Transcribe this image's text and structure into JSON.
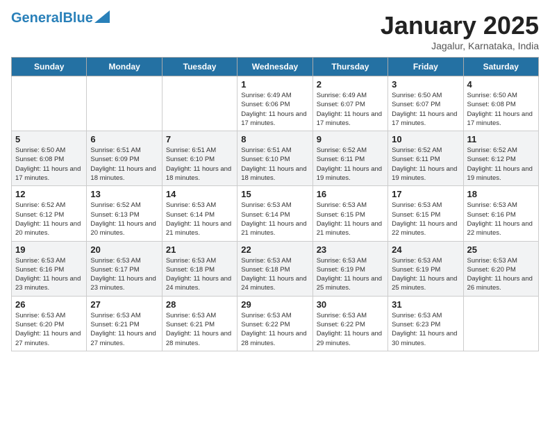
{
  "header": {
    "logo_line1": "General",
    "logo_line2": "Blue",
    "month": "January 2025",
    "location": "Jagalur, Karnataka, India"
  },
  "days_of_week": [
    "Sunday",
    "Monday",
    "Tuesday",
    "Wednesday",
    "Thursday",
    "Friday",
    "Saturday"
  ],
  "weeks": [
    [
      {
        "day": "",
        "info": ""
      },
      {
        "day": "",
        "info": ""
      },
      {
        "day": "",
        "info": ""
      },
      {
        "day": "1",
        "info": "Sunrise: 6:49 AM\nSunset: 6:06 PM\nDaylight: 11 hours and 17 minutes."
      },
      {
        "day": "2",
        "info": "Sunrise: 6:49 AM\nSunset: 6:07 PM\nDaylight: 11 hours and 17 minutes."
      },
      {
        "day": "3",
        "info": "Sunrise: 6:50 AM\nSunset: 6:07 PM\nDaylight: 11 hours and 17 minutes."
      },
      {
        "day": "4",
        "info": "Sunrise: 6:50 AM\nSunset: 6:08 PM\nDaylight: 11 hours and 17 minutes."
      }
    ],
    [
      {
        "day": "5",
        "info": "Sunrise: 6:50 AM\nSunset: 6:08 PM\nDaylight: 11 hours and 17 minutes."
      },
      {
        "day": "6",
        "info": "Sunrise: 6:51 AM\nSunset: 6:09 PM\nDaylight: 11 hours and 18 minutes."
      },
      {
        "day": "7",
        "info": "Sunrise: 6:51 AM\nSunset: 6:10 PM\nDaylight: 11 hours and 18 minutes."
      },
      {
        "day": "8",
        "info": "Sunrise: 6:51 AM\nSunset: 6:10 PM\nDaylight: 11 hours and 18 minutes."
      },
      {
        "day": "9",
        "info": "Sunrise: 6:52 AM\nSunset: 6:11 PM\nDaylight: 11 hours and 19 minutes."
      },
      {
        "day": "10",
        "info": "Sunrise: 6:52 AM\nSunset: 6:11 PM\nDaylight: 11 hours and 19 minutes."
      },
      {
        "day": "11",
        "info": "Sunrise: 6:52 AM\nSunset: 6:12 PM\nDaylight: 11 hours and 19 minutes."
      }
    ],
    [
      {
        "day": "12",
        "info": "Sunrise: 6:52 AM\nSunset: 6:12 PM\nDaylight: 11 hours and 20 minutes."
      },
      {
        "day": "13",
        "info": "Sunrise: 6:52 AM\nSunset: 6:13 PM\nDaylight: 11 hours and 20 minutes."
      },
      {
        "day": "14",
        "info": "Sunrise: 6:53 AM\nSunset: 6:14 PM\nDaylight: 11 hours and 21 minutes."
      },
      {
        "day": "15",
        "info": "Sunrise: 6:53 AM\nSunset: 6:14 PM\nDaylight: 11 hours and 21 minutes."
      },
      {
        "day": "16",
        "info": "Sunrise: 6:53 AM\nSunset: 6:15 PM\nDaylight: 11 hours and 21 minutes."
      },
      {
        "day": "17",
        "info": "Sunrise: 6:53 AM\nSunset: 6:15 PM\nDaylight: 11 hours and 22 minutes."
      },
      {
        "day": "18",
        "info": "Sunrise: 6:53 AM\nSunset: 6:16 PM\nDaylight: 11 hours and 22 minutes."
      }
    ],
    [
      {
        "day": "19",
        "info": "Sunrise: 6:53 AM\nSunset: 6:16 PM\nDaylight: 11 hours and 23 minutes."
      },
      {
        "day": "20",
        "info": "Sunrise: 6:53 AM\nSunset: 6:17 PM\nDaylight: 11 hours and 23 minutes."
      },
      {
        "day": "21",
        "info": "Sunrise: 6:53 AM\nSunset: 6:18 PM\nDaylight: 11 hours and 24 minutes."
      },
      {
        "day": "22",
        "info": "Sunrise: 6:53 AM\nSunset: 6:18 PM\nDaylight: 11 hours and 24 minutes."
      },
      {
        "day": "23",
        "info": "Sunrise: 6:53 AM\nSunset: 6:19 PM\nDaylight: 11 hours and 25 minutes."
      },
      {
        "day": "24",
        "info": "Sunrise: 6:53 AM\nSunset: 6:19 PM\nDaylight: 11 hours and 25 minutes."
      },
      {
        "day": "25",
        "info": "Sunrise: 6:53 AM\nSunset: 6:20 PM\nDaylight: 11 hours and 26 minutes."
      }
    ],
    [
      {
        "day": "26",
        "info": "Sunrise: 6:53 AM\nSunset: 6:20 PM\nDaylight: 11 hours and 27 minutes."
      },
      {
        "day": "27",
        "info": "Sunrise: 6:53 AM\nSunset: 6:21 PM\nDaylight: 11 hours and 27 minutes."
      },
      {
        "day": "28",
        "info": "Sunrise: 6:53 AM\nSunset: 6:21 PM\nDaylight: 11 hours and 28 minutes."
      },
      {
        "day": "29",
        "info": "Sunrise: 6:53 AM\nSunset: 6:22 PM\nDaylight: 11 hours and 28 minutes."
      },
      {
        "day": "30",
        "info": "Sunrise: 6:53 AM\nSunset: 6:22 PM\nDaylight: 11 hours and 29 minutes."
      },
      {
        "day": "31",
        "info": "Sunrise: 6:53 AM\nSunset: 6:23 PM\nDaylight: 11 hours and 30 minutes."
      },
      {
        "day": "",
        "info": ""
      }
    ]
  ]
}
